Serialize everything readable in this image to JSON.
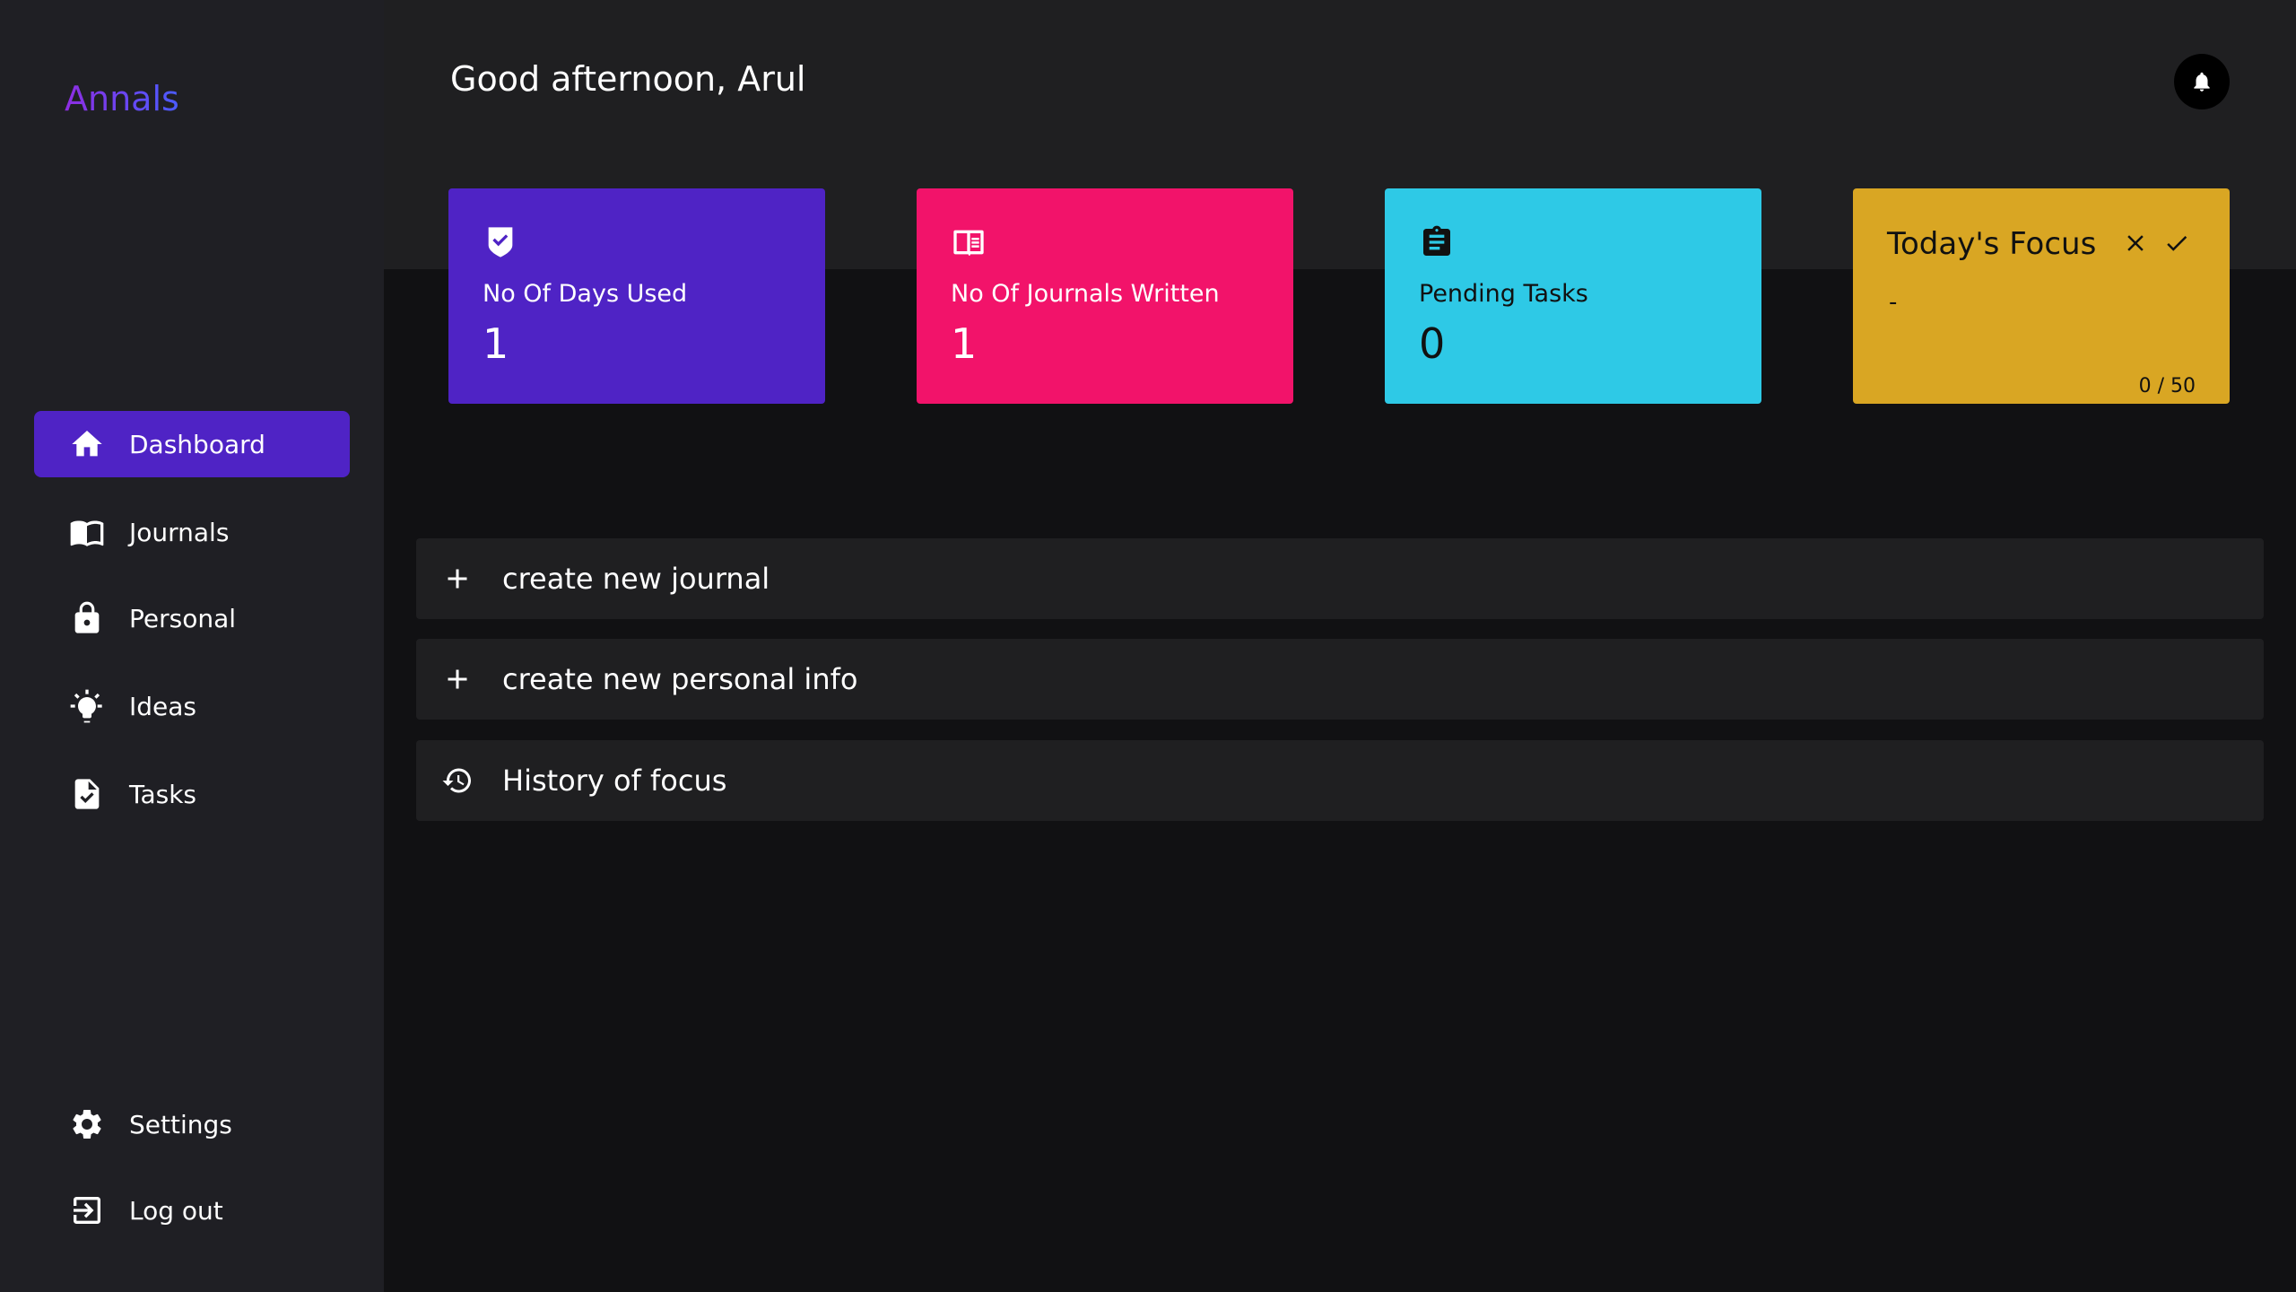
{
  "brand": "Annals",
  "sidebar": {
    "items": [
      {
        "label": "Dashboard",
        "icon": "home-icon",
        "active": true
      },
      {
        "label": "Journals",
        "icon": "book-icon"
      },
      {
        "label": "Personal",
        "icon": "lock-icon"
      },
      {
        "label": "Ideas",
        "icon": "lightbulb-icon"
      },
      {
        "label": "Tasks",
        "icon": "task-file-icon"
      }
    ],
    "bottom": [
      {
        "label": "Settings",
        "icon": "gear-icon"
      },
      {
        "label": "Log out",
        "icon": "logout-icon"
      }
    ]
  },
  "header": {
    "greeting": "Good afternoon, Arul",
    "bell_icon": "bell-icon"
  },
  "cards": [
    {
      "label": "No Of Days Used",
      "value": "1",
      "icon": "shield-check-icon",
      "color": "#4f23c5"
    },
    {
      "label": "No Of Journals Written",
      "value": "1",
      "icon": "open-book-icon",
      "color": "#f2136a"
    },
    {
      "label": "Pending Tasks",
      "value": "0",
      "icon": "clipboard-icon",
      "color": "#2ec9e6"
    }
  ],
  "focus": {
    "title": "Today's Focus",
    "value": "-",
    "counter": "0 / 50",
    "color": "#d9a623"
  },
  "actions": [
    {
      "label": "create new journal",
      "icon": "plus-icon"
    },
    {
      "label": "create new personal info",
      "icon": "plus-icon"
    },
    {
      "label": "History of focus",
      "icon": "history-icon"
    }
  ],
  "colors": {
    "sidebar_bg": "#1f1f24",
    "main_bg": "#111113",
    "accent": "#4f23c5"
  }
}
